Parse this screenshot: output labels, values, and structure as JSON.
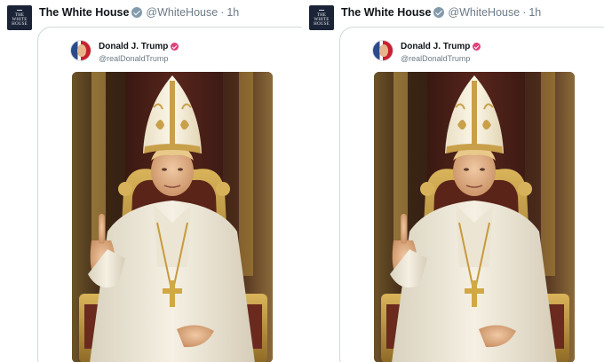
{
  "panels": [
    {
      "account": {
        "avatar_text": [
          "THE",
          "WHITE",
          "HOUSE"
        ],
        "name": "The White House",
        "handle": "@WhiteHouse",
        "separator": "·",
        "time": "1h",
        "badge": "government-check-icon",
        "badge_color": "#829aab"
      },
      "quote": {
        "name": "Donald J. Trump",
        "handle": "@realDonaldTrump",
        "badge": "verified-check-icon",
        "badge_color": "#e0407b",
        "image": "pope-portrait-image"
      }
    },
    {
      "account": {
        "avatar_text": [
          "THE",
          "WHITE",
          "HOUSE"
        ],
        "name": "The White House",
        "handle": "@WhiteHouse",
        "separator": "·",
        "time": "1h",
        "badge": "government-check-icon",
        "badge_color": "#829aab"
      },
      "quote": {
        "name": "Donald J. Trump",
        "handle": "@realDonaldTrump",
        "badge": "verified-check-icon",
        "badge_color": "#e0407b",
        "image": "pope-portrait-image"
      }
    }
  ]
}
